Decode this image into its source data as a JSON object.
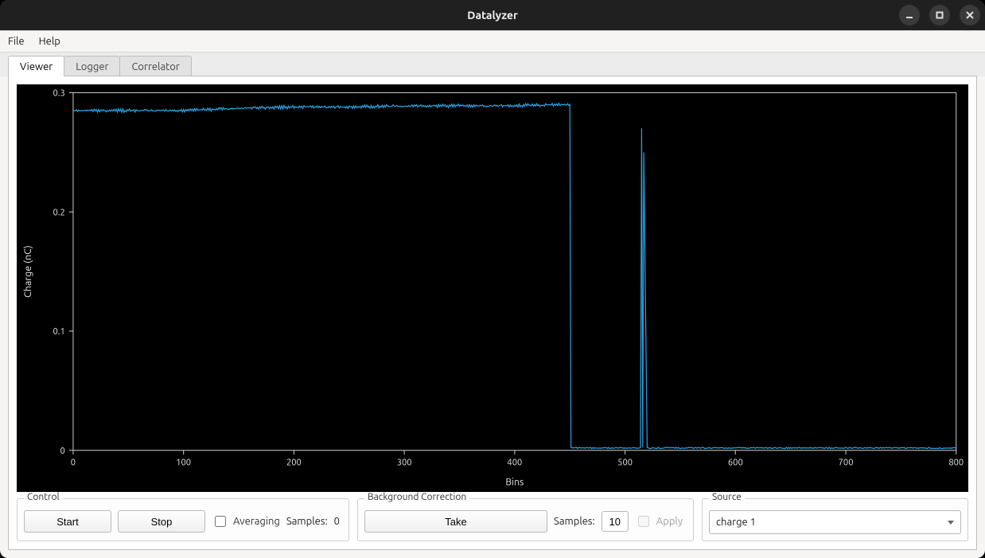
{
  "window": {
    "title": "Datalyzer"
  },
  "menu": {
    "file": "File",
    "help": "Help"
  },
  "tabs": {
    "viewer": "Viewer",
    "logger": "Logger",
    "correlator": "Correlator"
  },
  "panels": {
    "control": {
      "title": "Control",
      "start": "Start",
      "stop": "Stop",
      "averaging": "Averaging",
      "samples_label": "Samples:",
      "samples_value": "0"
    },
    "bg": {
      "title": "Background Correction",
      "take": "Take",
      "samples_label": "Samples:",
      "samples_value": "10",
      "apply": "Apply"
    },
    "source": {
      "title": "Source",
      "selected": "charge 1"
    }
  },
  "chart_data": {
    "type": "line",
    "title": "",
    "xlabel": "Bins",
    "ylabel": "Charge (nC)",
    "xlim": [
      0,
      800
    ],
    "ylim": [
      0,
      0.3
    ],
    "xticks": [
      0,
      100,
      200,
      300,
      400,
      500,
      600,
      700,
      800
    ],
    "yticks": [
      0,
      0.1,
      0.2,
      0.3
    ],
    "series": [
      {
        "name": "charge 1",
        "color": "#2aa1e0",
        "x": [
          0,
          50,
          100,
          150,
          200,
          250,
          300,
          350,
          400,
          440,
          450,
          451,
          514,
          515,
          516,
          517,
          520,
          600,
          700,
          800
        ],
        "y": [
          0.285,
          0.285,
          0.285,
          0.287,
          0.288,
          0.288,
          0.289,
          0.289,
          0.289,
          0.29,
          0.29,
          0.002,
          0.002,
          0.27,
          0.002,
          0.25,
          0.002,
          0.002,
          0.002,
          0.002
        ]
      }
    ]
  }
}
